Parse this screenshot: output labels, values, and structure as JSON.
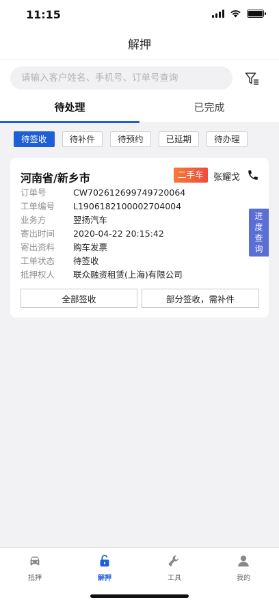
{
  "status_bar": {
    "time": "11:15"
  },
  "nav": {
    "title": "解押"
  },
  "search": {
    "placeholder": "请输入客户姓名、手机号、订单号查询"
  },
  "tabs": [
    {
      "label": "待处理",
      "active": true
    },
    {
      "label": "已完成",
      "active": false
    }
  ],
  "chips": [
    {
      "label": "待签收",
      "active": true
    },
    {
      "label": "待补件",
      "active": false
    },
    {
      "label": "待预约",
      "active": false
    },
    {
      "label": "已延期",
      "active": false
    },
    {
      "label": "待办理",
      "active": false
    }
  ],
  "card": {
    "city": "河南省/新乡市",
    "badge": "二手车",
    "person": "张耀戈",
    "fields": [
      {
        "label": "订单号",
        "value": "CW702612699749720064"
      },
      {
        "label": "工单编号",
        "value": "L1906182100002704004"
      },
      {
        "label": "业务方",
        "value": "翌扬汽车"
      },
      {
        "label": "寄出时间",
        "value": "2020-04-22 20:15:42"
      },
      {
        "label": "寄出资料",
        "value": "购车发票"
      },
      {
        "label": "工单状态",
        "value": "待签收"
      },
      {
        "label": "抵押权人",
        "value": "联众融资租赁(上海)有限公司"
      }
    ],
    "progress_label": [
      "进",
      "度",
      "查",
      "询"
    ],
    "btn_all": "全部签收",
    "btn_partial": "部分签收，需补件"
  },
  "tabbar": [
    {
      "label": "抵押",
      "icon": "car-icon"
    },
    {
      "label": "解押",
      "icon": "unlock-icon",
      "active": true
    },
    {
      "label": "工具",
      "icon": "wrench-icon"
    },
    {
      "label": "我的",
      "icon": "user-icon"
    }
  ],
  "colors": {
    "accent": "#1f5fd6",
    "badge": "#ee4b3c",
    "progress_tab": "#5b6ed4"
  }
}
